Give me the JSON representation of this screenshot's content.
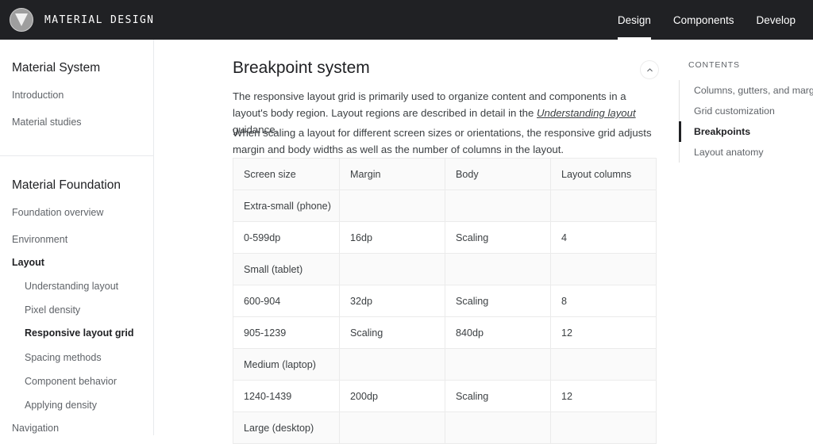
{
  "topbar": {
    "brand": "MATERIAL DESIGN",
    "logo_icon": "material-design-logo",
    "nav": [
      {
        "label": "Design",
        "active": true
      },
      {
        "label": "Components",
        "active": false
      },
      {
        "label": "Develop",
        "active": false
      }
    ]
  },
  "sidebar": {
    "sections": [
      {
        "title": "Material System",
        "items": [
          {
            "label": "Introduction",
            "bold": false,
            "sub": false
          },
          {
            "label": "Material studies",
            "bold": false,
            "sub": false
          }
        ]
      },
      {
        "title": "Material Foundation",
        "items": [
          {
            "label": "Foundation overview",
            "bold": false,
            "sub": false
          },
          {
            "label": "Environment",
            "bold": false,
            "sub": false
          },
          {
            "label": "Layout",
            "bold": true,
            "sub": false
          },
          {
            "label": "Understanding layout",
            "bold": false,
            "sub": true
          },
          {
            "label": "Pixel density",
            "bold": false,
            "sub": true
          },
          {
            "label": "Responsive layout grid",
            "bold": true,
            "sub": true
          },
          {
            "label": "Spacing methods",
            "bold": false,
            "sub": true
          },
          {
            "label": "Component behavior",
            "bold": false,
            "sub": true
          },
          {
            "label": "Applying density",
            "bold": false,
            "sub": true
          },
          {
            "label": "Navigation",
            "bold": false,
            "sub": false
          }
        ]
      }
    ]
  },
  "main": {
    "title": "Breakpoint system",
    "collapse_icon": "chevron-up-icon",
    "paragraph1_before": "The responsive layout grid is primarily used to organize content and components in a layout's body region. Layout regions are described in detail in the ",
    "paragraph1_link": "Understanding layout",
    "paragraph1_after": " guidance.",
    "paragraph2": "When scaling a layout for different screen sizes or orientations, the responsive grid adjusts margin and body widths as well as the number of columns in the layout.",
    "table": {
      "headers": [
        "Screen size",
        "Margin",
        "Body",
        "Layout columns"
      ],
      "rows": [
        {
          "type": "group",
          "cells": [
            "Extra-small (phone)",
            "",
            "",
            ""
          ]
        },
        {
          "type": "data",
          "cells": [
            "0-599dp",
            "16dp",
            "Scaling",
            "4"
          ]
        },
        {
          "type": "group",
          "cells": [
            "Small (tablet)",
            "",
            "",
            ""
          ]
        },
        {
          "type": "data",
          "cells": [
            "600-904",
            "32dp",
            "Scaling",
            "8"
          ]
        },
        {
          "type": "data",
          "cells": [
            "905-1239",
            "Scaling",
            "840dp",
            "12"
          ]
        },
        {
          "type": "group",
          "cells": [
            "Medium (laptop)",
            "",
            "",
            ""
          ]
        },
        {
          "type": "data",
          "cells": [
            "1240-1439",
            "200dp",
            "Scaling",
            "12"
          ]
        },
        {
          "type": "group",
          "cells": [
            "Large (desktop)",
            "",
            "",
            ""
          ]
        }
      ]
    }
  },
  "contents": {
    "label": "CONTENTS",
    "items": [
      {
        "label": "Columns, gutters, and margins",
        "active": false
      },
      {
        "label": "Grid customization",
        "active": false
      },
      {
        "label": "Breakpoints",
        "active": true
      },
      {
        "label": "Layout anatomy",
        "active": false
      }
    ]
  }
}
